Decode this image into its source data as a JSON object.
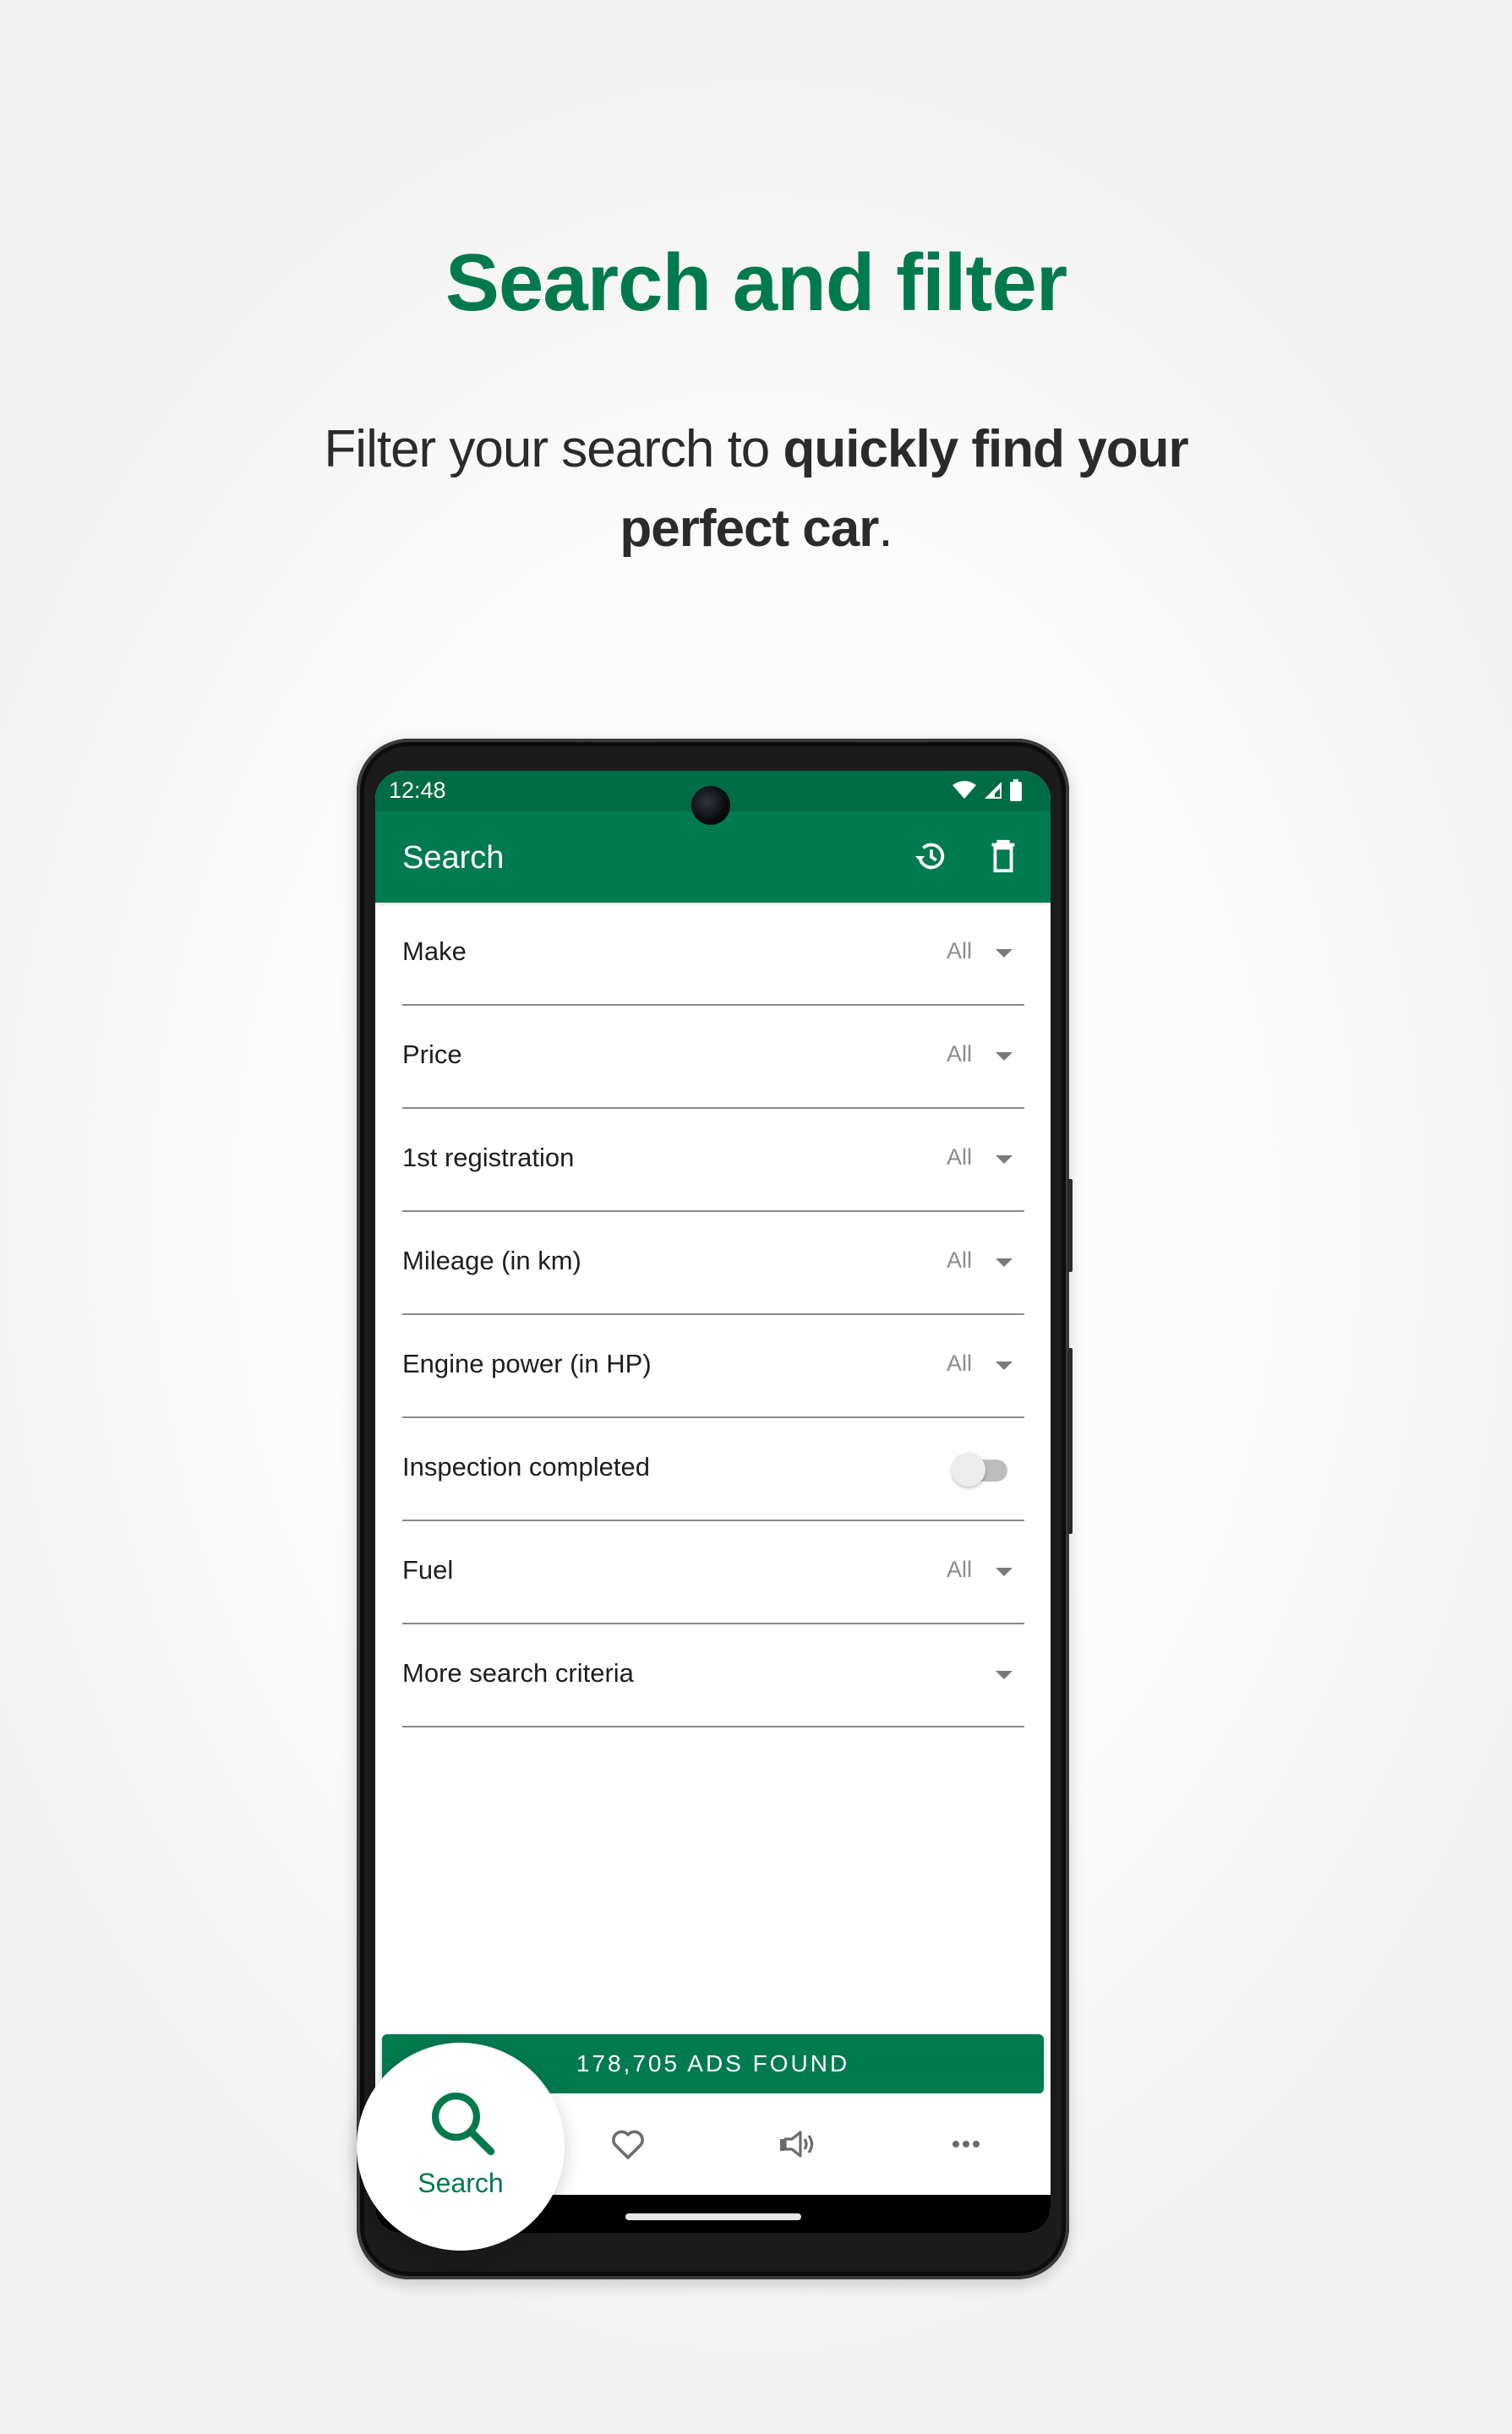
{
  "promo": {
    "headline": "Search and filter",
    "subtitle_regular": "Filter your search to ",
    "subtitle_bold_1": "quickly find your",
    "subtitle_bold_2": "perfect car",
    "subtitle_end": "."
  },
  "colors": {
    "brand_green": "#007a4d",
    "status_bar_green": "#006c45",
    "divider": "#8a8a8a"
  },
  "status_bar": {
    "time": "12:48",
    "icons": [
      "wifi-icon",
      "signal-icon",
      "battery-icon"
    ]
  },
  "app_bar": {
    "title": "Search",
    "actions": [
      {
        "name": "history-icon",
        "label": "Search history"
      },
      {
        "name": "trash-icon",
        "label": "Delete"
      }
    ]
  },
  "filters": [
    {
      "label": "Make",
      "value": "All",
      "type": "dropdown"
    },
    {
      "label": "Price",
      "value": "All",
      "type": "dropdown"
    },
    {
      "label": "1st registration",
      "value": "All",
      "type": "dropdown"
    },
    {
      "label": "Mileage (in km)",
      "value": "All",
      "type": "dropdown"
    },
    {
      "label": "Engine power (in HP)",
      "value": "All",
      "type": "dropdown"
    },
    {
      "label": "Inspection completed",
      "value": false,
      "type": "toggle"
    },
    {
      "label": "Fuel",
      "value": "All",
      "type": "dropdown"
    },
    {
      "label": "More search criteria",
      "value": "",
      "type": "expand"
    }
  ],
  "results_button": {
    "label": "178,705 ADS FOUND"
  },
  "bottom_nav": {
    "active": {
      "label": "Search",
      "icon": "search-icon"
    },
    "items": [
      {
        "icon": "heart-icon"
      },
      {
        "icon": "megaphone-icon"
      },
      {
        "icon": "more-dots-icon"
      }
    ]
  }
}
